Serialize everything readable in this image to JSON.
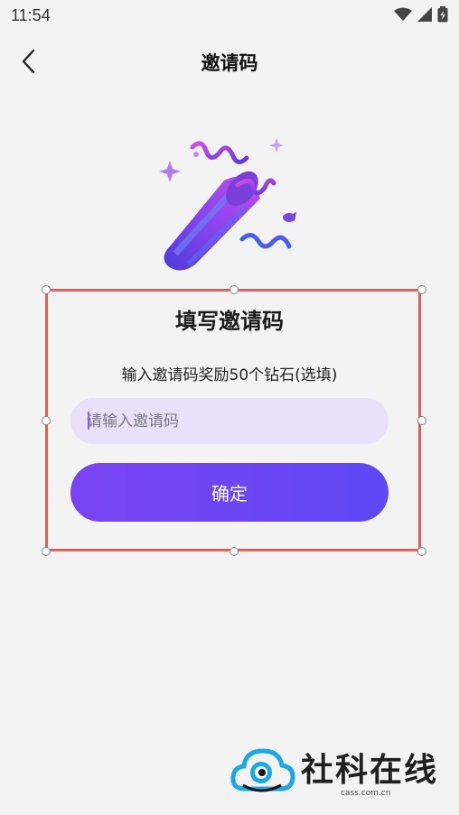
{
  "status_bar": {
    "time": "11:54"
  },
  "nav": {
    "title": "邀请码"
  },
  "card": {
    "title": "填写邀请码",
    "subtitle": "输入邀请码奖励50个钻石(选填)",
    "input_placeholder": "请输入邀请码",
    "confirm_label": "确定"
  },
  "watermark": {
    "text": "社科在线",
    "sub": "cass.com.cn"
  },
  "colors": {
    "accent": "#6a46f3",
    "input_bg": "#e9e0fb",
    "frame": "#d9625e",
    "background": "#f3f3f3"
  }
}
